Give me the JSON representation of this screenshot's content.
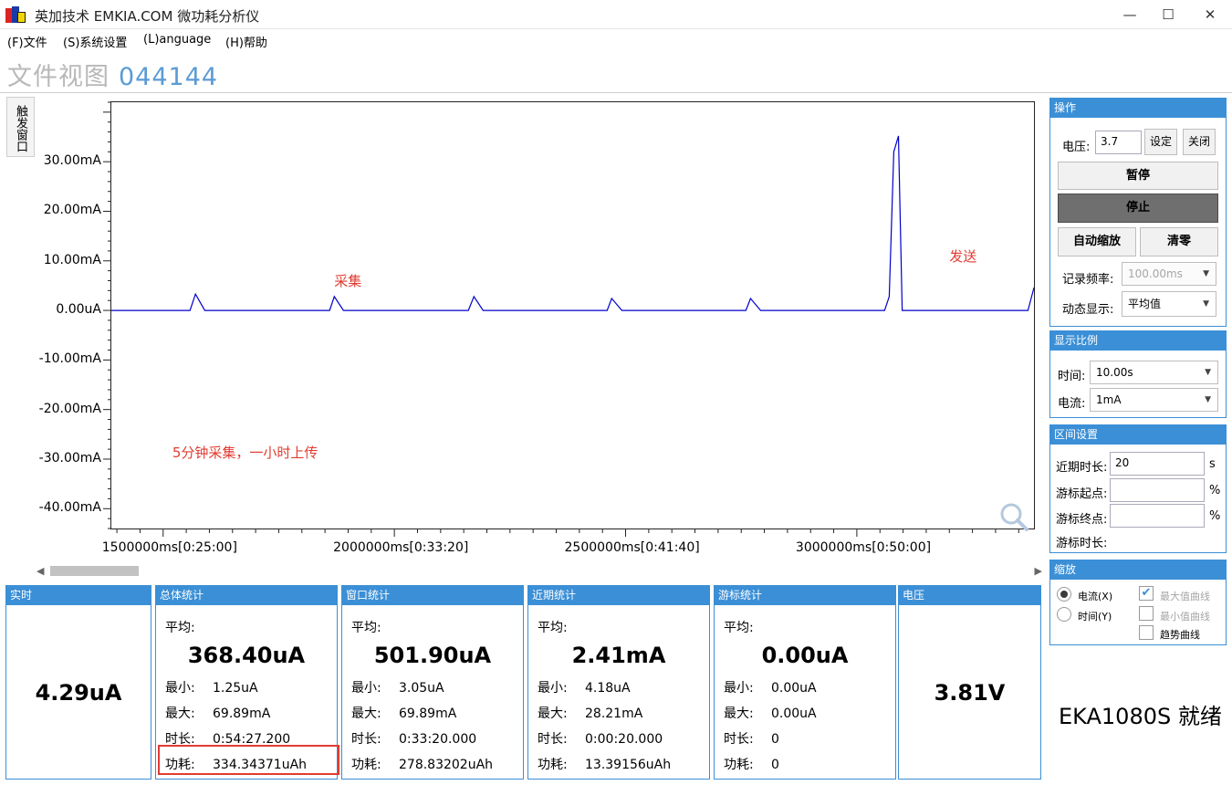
{
  "window": {
    "title": "英加技术 EMKIA.COM 微功耗分析仪",
    "minimize_glyph": "—",
    "maximize_glyph": "☐",
    "close_glyph": "✕"
  },
  "menu": [
    "(F)文件",
    "(S)系统设置",
    "(L)anguage",
    "(H)帮助"
  ],
  "view": {
    "title": "文件视图",
    "file_id": "044144"
  },
  "trigger_button": "触发窗口",
  "chart_data": {
    "type": "line",
    "ylim": [
      -44,
      42
    ],
    "y_ticks": [
      {
        "value": 30,
        "label": "30.00mA"
      },
      {
        "value": 20,
        "label": "20.00mA"
      },
      {
        "value": 10,
        "label": "10.00mA"
      },
      {
        "value": 0,
        "label": "0.00uA"
      },
      {
        "value": -10,
        "label": "-10.00mA"
      },
      {
        "value": -20,
        "label": "-20.00mA"
      },
      {
        "value": -30,
        "label": "-30.00mA"
      },
      {
        "value": -40,
        "label": "-40.00mA"
      }
    ],
    "xlim": [
      1388000,
      3383000
    ],
    "x_ticks": [
      {
        "value": 1500000,
        "label": "1500000ms[0:25:00]"
      },
      {
        "value": 2000000,
        "label": "2000000ms[0:33:20]"
      },
      {
        "value": 2500000,
        "label": "2500000ms[0:41:40]"
      },
      {
        "value": 3000000,
        "label": "3000000ms[0:50:00]"
      }
    ],
    "series": [
      {
        "color": "#0000cc",
        "x": [
          1388000,
          1558000,
          1570000,
          1590000,
          1860000,
          1870000,
          1890000,
          2160000,
          2172000,
          2192000,
          2460000,
          2470000,
          2492000,
          2760000,
          2770000,
          2792000,
          3060000,
          3070000,
          3080000,
          3090000,
          3098000,
          3370000,
          3383000
        ],
        "y": [
          0,
          0,
          3.3,
          0,
          0,
          2.8,
          0,
          0,
          2.8,
          0,
          0,
          2.4,
          0,
          0,
          2.4,
          0,
          0,
          2.8,
          32,
          35.2,
          0,
          0,
          4.6
        ]
      }
    ],
    "annotations": [
      {
        "text": "采集",
        "x": 1870000,
        "y": 6
      },
      {
        "text": "发送",
        "x": 3200000,
        "y": 11
      },
      {
        "text": "5分钟采集，一小时上传",
        "x": 1520000,
        "y": -28.5
      }
    ]
  },
  "ops": {
    "header": "操作",
    "voltage_label": "电压:",
    "voltage_value": "3.7",
    "set_label": "设定",
    "close_label": "关闭",
    "pause_label": "暂停",
    "stop_label": "停止",
    "autoscale_label": "自动缩放",
    "zero_label": "清零",
    "rate_label": "记录频率:",
    "rate_value": "100.00ms",
    "dynamic_label": "动态显示:",
    "dynamic_value": "平均值"
  },
  "scale": {
    "header": "显示比例",
    "time_label": "时间:",
    "time_value": "10.00s",
    "current_label": "电流:",
    "current_value": "1mA"
  },
  "interval": {
    "header": "区间设置",
    "recent_label": "近期时长:",
    "recent_value": "20",
    "recent_unit": "s",
    "cursor_start_label": "游标起点:",
    "cursor_start_unit": "%",
    "cursor_end_label": "游标终点:",
    "cursor_end_unit": "%",
    "cursor_len_label": "游标时长:"
  },
  "zoom": {
    "header": "缩放",
    "current_x": "电流(X)",
    "time_y": "时间(Y)",
    "max_curve": "最大值曲线",
    "min_curve": "最小值曲线",
    "trend_curve": "趋势曲线",
    "current_selected": true,
    "max_checked": true
  },
  "stats": {
    "realtime": {
      "header": "实时",
      "value": "4.29uA"
    },
    "labels": {
      "avg": "平均:",
      "min": "最小:",
      "max": "最大:",
      "dur": "时长:",
      "energy": "功耗:"
    },
    "total": {
      "header": "总体统计",
      "avg": "368.40uA",
      "min": "1.25uA",
      "max": "69.89mA",
      "dur": "0:54:27.200",
      "energy": "334.34371uAh"
    },
    "window": {
      "header": "窗口统计",
      "avg": "501.90uA",
      "min": "3.05uA",
      "max": "69.89mA",
      "dur": "0:33:20.000",
      "energy": "278.83202uAh"
    },
    "recent": {
      "header": "近期统计",
      "avg": "2.41mA",
      "min": "4.18uA",
      "max": "28.21mA",
      "dur": "0:00:20.000",
      "energy": "13.39156uAh"
    },
    "cursor": {
      "header": "游标统计",
      "avg": "0.00uA",
      "min": "0.00uA",
      "max": "0.00uA",
      "dur": "0",
      "energy": "0"
    },
    "voltage": {
      "header": "电压",
      "value": "3.81V"
    }
  },
  "status": "EKA1080S  就绪",
  "colors": {
    "accent": "#3b8fd6",
    "annotation": "#e03c31",
    "trace": "#0000cc"
  }
}
